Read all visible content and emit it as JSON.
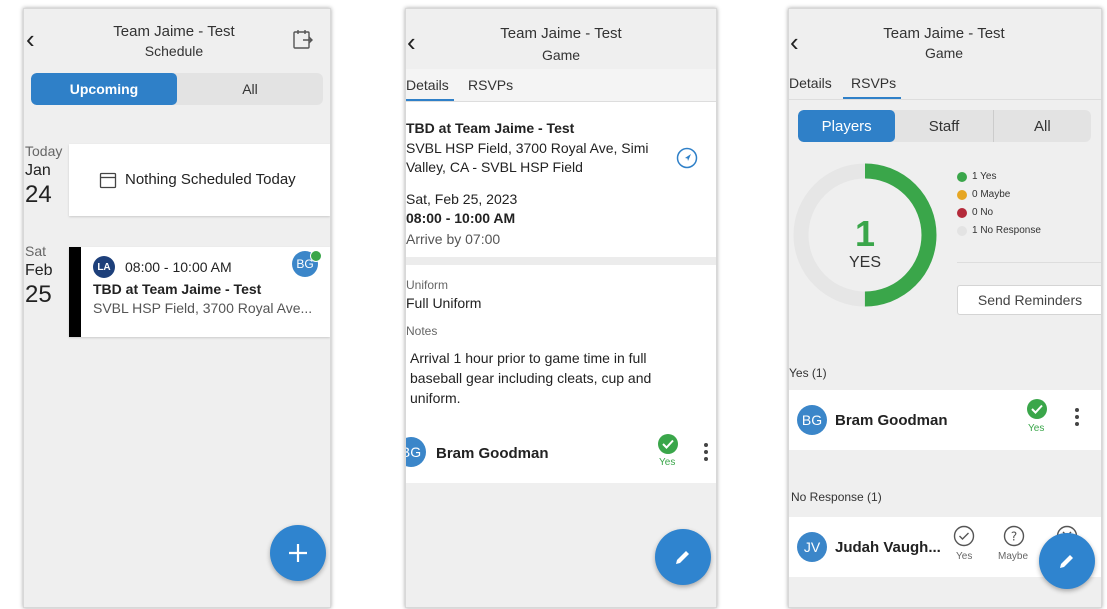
{
  "colors": {
    "accent": "#2f80c8",
    "yes": "#3aa64a",
    "maybe": "#e6a623",
    "no": "#b42a3a",
    "no_response": "#e3e3e3"
  },
  "schedule": {
    "team": "Team Jaime - Test",
    "subtitle": "Schedule",
    "toggle": [
      "Upcoming",
      "All"
    ],
    "today_label": "Today",
    "today_month": "Jan",
    "today_day": "24",
    "nothing_text": "Nothing Scheduled Today",
    "event_dow": "Sat",
    "event_month": "Feb",
    "event_day": "25",
    "event_time": "08:00 - 10:00 AM",
    "event_title": "TBD at Team Jaime - Test",
    "event_location": "SVBL HSP Field, 3700 Royal Ave...",
    "event_avatar": "BG",
    "team_logo": "LA"
  },
  "game": {
    "team": "Team Jaime - Test",
    "subtitle": "Game",
    "tabs": [
      "Details",
      "RSVPs"
    ],
    "title": "TBD at Team Jaime - Test",
    "address_line1": "SVBL HSP Field, 3700 Royal Ave, Simi",
    "address_line2": "Valley, CA - SVBL HSP Field",
    "date": "Sat, Feb 25, 2023",
    "time": "08:00 - 10:00 AM",
    "arrive": "Arrive by 07:00",
    "uniform_label": "Uniform",
    "uniform_value": "Full Uniform",
    "notes_label": "Notes",
    "notes_line1": "Arrival 1 hour prior to game time in full",
    "notes_line2": "baseball gear including cleats, cup and",
    "notes_line3": "uniform.",
    "rsvp_initials": "BG",
    "rsvp_name": "Bram Goodman",
    "rsvp_status": "Yes"
  },
  "rsvps": {
    "team": "Team Jaime - Test",
    "subtitle": "Game",
    "tabs": [
      "Details",
      "RSVPs"
    ],
    "segments": [
      "Players",
      "Staff",
      "All"
    ],
    "big_number": "1",
    "big_label": "YES",
    "yes_fraction": 0.5,
    "legend": [
      "1 Yes",
      "0 Maybe",
      "0 No",
      "1 No Response"
    ],
    "send_reminders": "Send Reminders",
    "yes_section": "Yes (1)",
    "yes_initials": "BG",
    "yes_name": "Bram Goodman",
    "yes_status": "Yes",
    "nr_section": "No Response (1)",
    "nr_initials": "JV",
    "nr_name": "Judah Vaugh...",
    "nr_opt_yes": "Yes",
    "nr_opt_maybe": "Maybe"
  }
}
